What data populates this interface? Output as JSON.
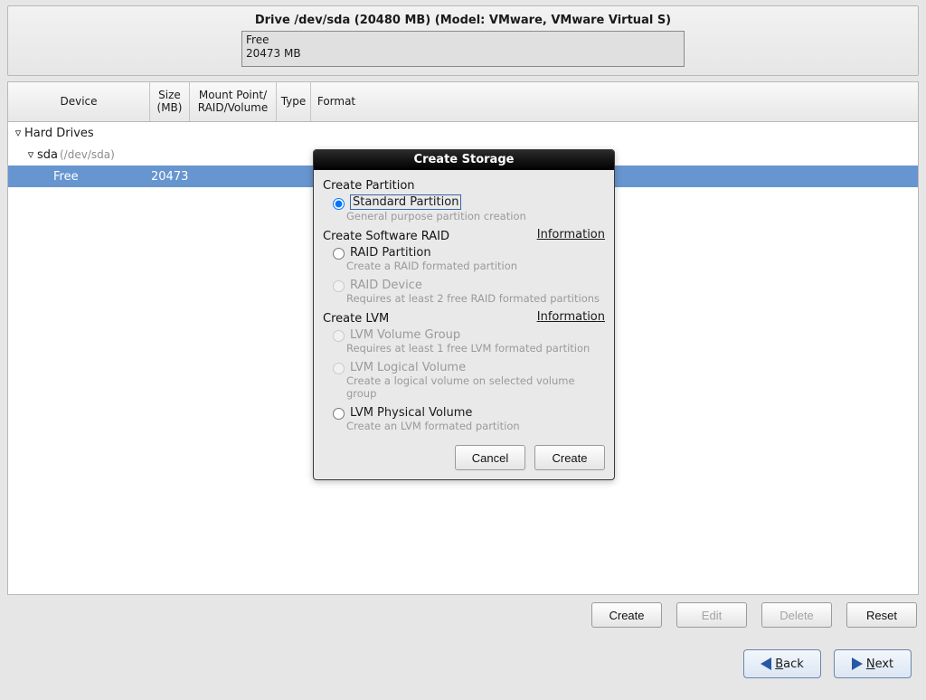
{
  "drive": {
    "title": "Drive /dev/sda (20480 MB) (Model: VMware, VMware Virtual S)",
    "free_label": "Free",
    "free_size": "20473 MB"
  },
  "columns": {
    "device": "Device",
    "size": "Size (MB)",
    "mount": "Mount Point/ RAID/Volume",
    "type": "Type",
    "format": "Format"
  },
  "tree": {
    "hard_drives": "Hard Drives",
    "sda": "sda",
    "sda_path": "(/dev/sda)",
    "free": "Free",
    "free_size": "20473"
  },
  "dialog": {
    "title": "Create Storage",
    "section_partition": "Create Partition",
    "standard_partition": "Standard Partition",
    "standard_hint": "General purpose partition creation",
    "section_raid": "Create Software RAID",
    "info": "Information",
    "raid_partition": "RAID Partition",
    "raid_partition_hint": "Create a RAID formated partition",
    "raid_device": "RAID Device",
    "raid_device_hint": "Requires at least 2 free RAID formated partitions",
    "section_lvm": "Create LVM",
    "lvm_vg": "LVM Volume Group",
    "lvm_vg_hint": "Requires at least 1 free LVM formated partition",
    "lvm_lv": "LVM Logical Volume",
    "lvm_lv_hint": "Create a logical volume on selected volume group",
    "lvm_pv": "LVM Physical Volume",
    "lvm_pv_hint": "Create an LVM formated partition",
    "cancel": "Cancel",
    "create": "Create"
  },
  "actions": {
    "create": "Create",
    "edit": "Edit",
    "delete": "Delete",
    "reset": "Reset"
  },
  "nav": {
    "back": "Back",
    "next": "Next"
  }
}
